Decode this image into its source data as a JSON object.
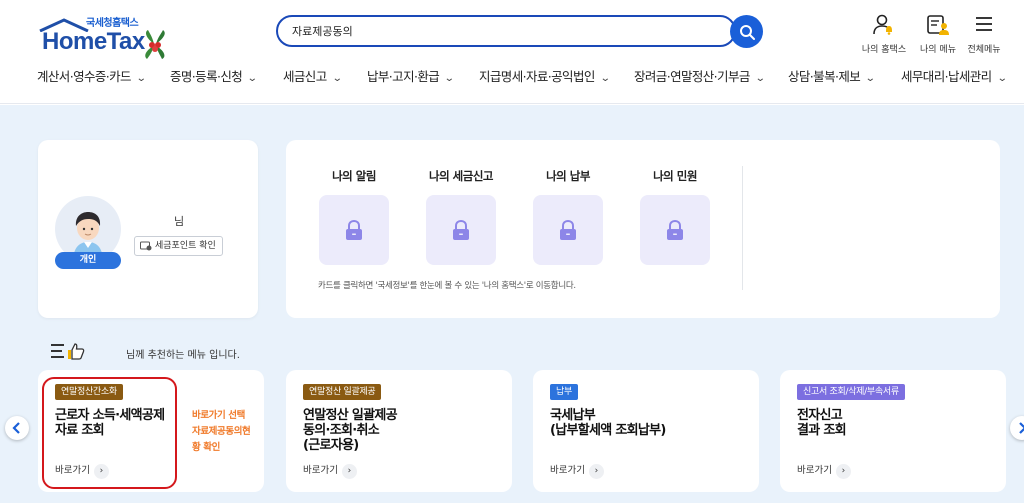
{
  "header": {
    "logo_sub": "국세청홈택스",
    "logo_main": "HomeTax",
    "search": {
      "value": "자료제공동의",
      "placeholder": ""
    },
    "icons": [
      {
        "name": "my-hometax",
        "label": "나의 홈택스"
      },
      {
        "name": "my-menu",
        "label": "나의 메뉴"
      },
      {
        "name": "all-menu",
        "label": "전체메뉴"
      }
    ]
  },
  "gnb": [
    "계산서·영수증·카드",
    "증명·등록·신청",
    "세금신고",
    "납부·고지·환급",
    "지급명세·자료·공익법인",
    "장려금·연말정산·기부금",
    "상담·불복·제보",
    "세무대리·납세관리"
  ],
  "profile": {
    "name_suffix": "님",
    "badge": "개인",
    "point_button": "세금포인트 확인"
  },
  "my_section": {
    "items": [
      "나의 알림",
      "나의 세금신고",
      "나의 납부",
      "나의 민원"
    ],
    "note": "카드를 클릭하면 '국세정보'를 한눈에 볼 수 있는 '나의 홈택스'로 이동합니다."
  },
  "recommend": {
    "text": "님께 추천하는 메뉴 입니다."
  },
  "rec_cards": [
    {
      "tag": "연말정산간소화",
      "tag_color": "#8a5a12",
      "title": "근로자 소득·세액공제\n자료 조회",
      "go": "바로가기",
      "side_note": "바로가기 선택\n자료제공동의현\n황 확인"
    },
    {
      "tag": "연말정산 일괄제공",
      "tag_color": "#8a5a12",
      "title": "연말정산 일괄제공\n동의·조회·취소\n(근로자용)",
      "go": "바로가기"
    },
    {
      "tag": "납부",
      "tag_color": "#2c73dd",
      "title": "국세납부\n(납부할세액 조회납부)",
      "go": "바로가기"
    },
    {
      "tag": "신고서 조회/삭제/부속서류",
      "tag_color": "#7c6fe0",
      "title": "전자신고\n결과 조회",
      "go": "바로가기"
    }
  ],
  "colors": {
    "brand": "#1f4fa8",
    "accent": "#1a5fd8",
    "highlight": "#d4181c",
    "background": "#e9f2fb"
  }
}
